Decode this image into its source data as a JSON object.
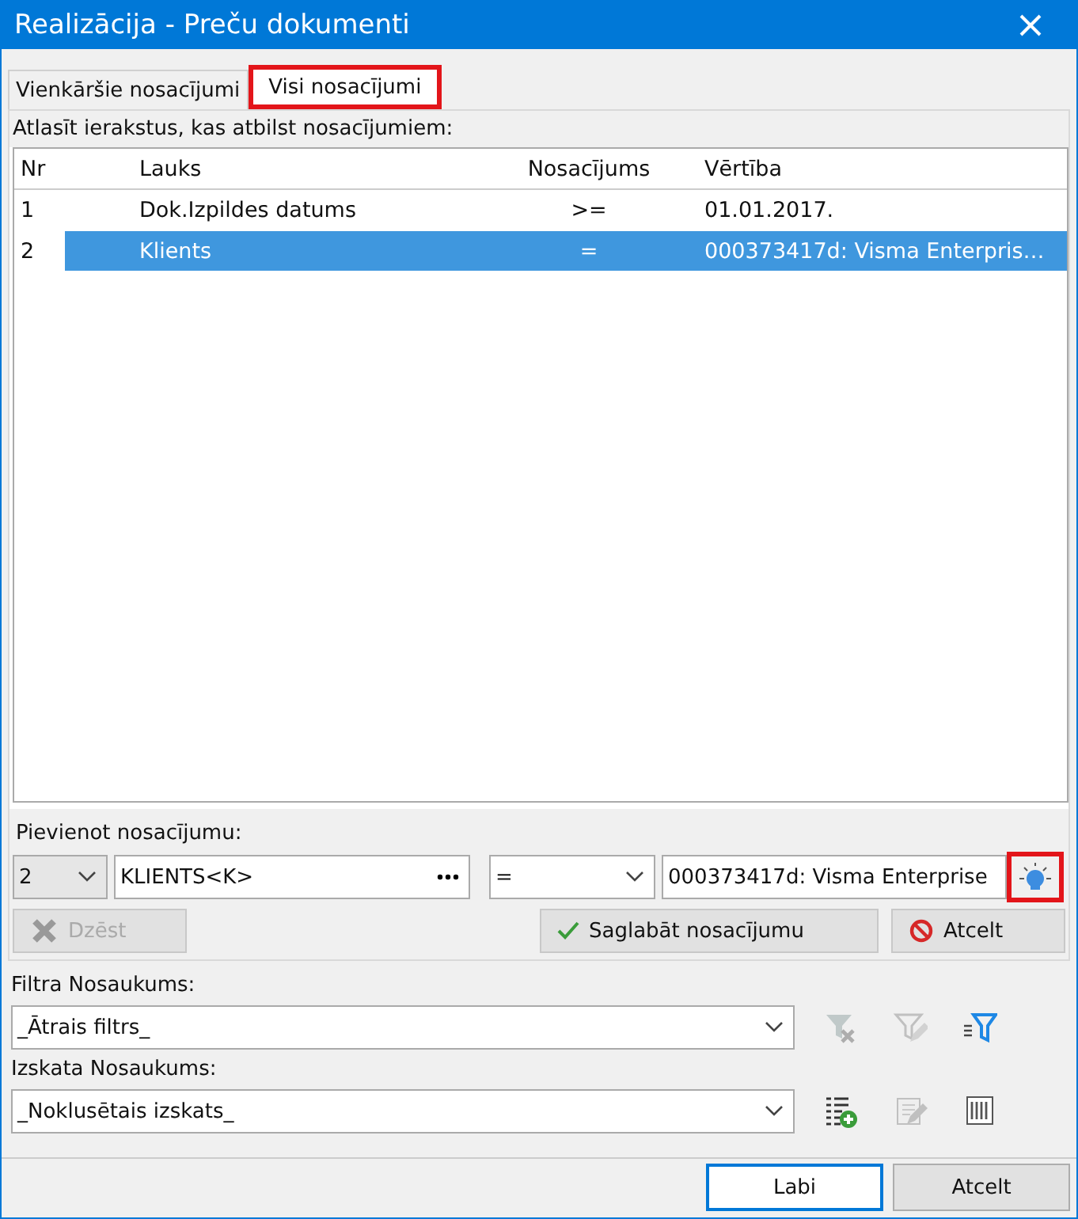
{
  "window": {
    "title": "Realizācija - Preču dokumenti"
  },
  "tabs": [
    {
      "label": "Vienkāršie nosacījumi",
      "selected": false,
      "highlighted": false
    },
    {
      "label": "Visi nosacījumi",
      "selected": true,
      "highlighted": true
    }
  ],
  "conditions": {
    "caption": "Atlasīt ierakstus, kas atbilst nosacījumiem:",
    "columns": [
      "Nr",
      "Lauks",
      "Nosacījums",
      "Vērtība"
    ],
    "rows": [
      {
        "nr": "1",
        "field": "Dok.Izpildes datums",
        "operator": ">=",
        "value": "01.01.2017.",
        "selected": false
      },
      {
        "nr": "2",
        "field": "Klients",
        "operator": "=",
        "value": "000373417d: Visma Enterpris…",
        "selected": true
      }
    ]
  },
  "add_condition": {
    "caption": "Pievienot nosacījumu:",
    "number": "2",
    "field": "KLIENTS<K>",
    "operator": "=",
    "value": "000373417d: Visma Enterprise",
    "lookup_highlighted": true,
    "delete_button": {
      "label": "Dzēst",
      "disabled": true
    },
    "save_button": "Saglabāt nosacījumu",
    "cancel_button": "Atcelt"
  },
  "filter": {
    "label": "Filtra Nosaukums:",
    "value": "_Ātrais filtrs_",
    "tools": [
      {
        "kind": "filter-delete",
        "disabled": true
      },
      {
        "kind": "filter-edit",
        "disabled": true
      },
      {
        "kind": "filter-list",
        "disabled": false
      }
    ]
  },
  "view": {
    "label": "Izskata Nosaukums:",
    "value": "_Noklusētais izskats_",
    "tools": [
      {
        "kind": "list-add",
        "disabled": false
      },
      {
        "kind": "edit",
        "disabled": true
      },
      {
        "kind": "columns",
        "disabled": false
      }
    ]
  },
  "buttons": [
    {
      "label": "Labi",
      "default": true
    },
    {
      "label": "Atcelt",
      "default": false
    }
  ]
}
